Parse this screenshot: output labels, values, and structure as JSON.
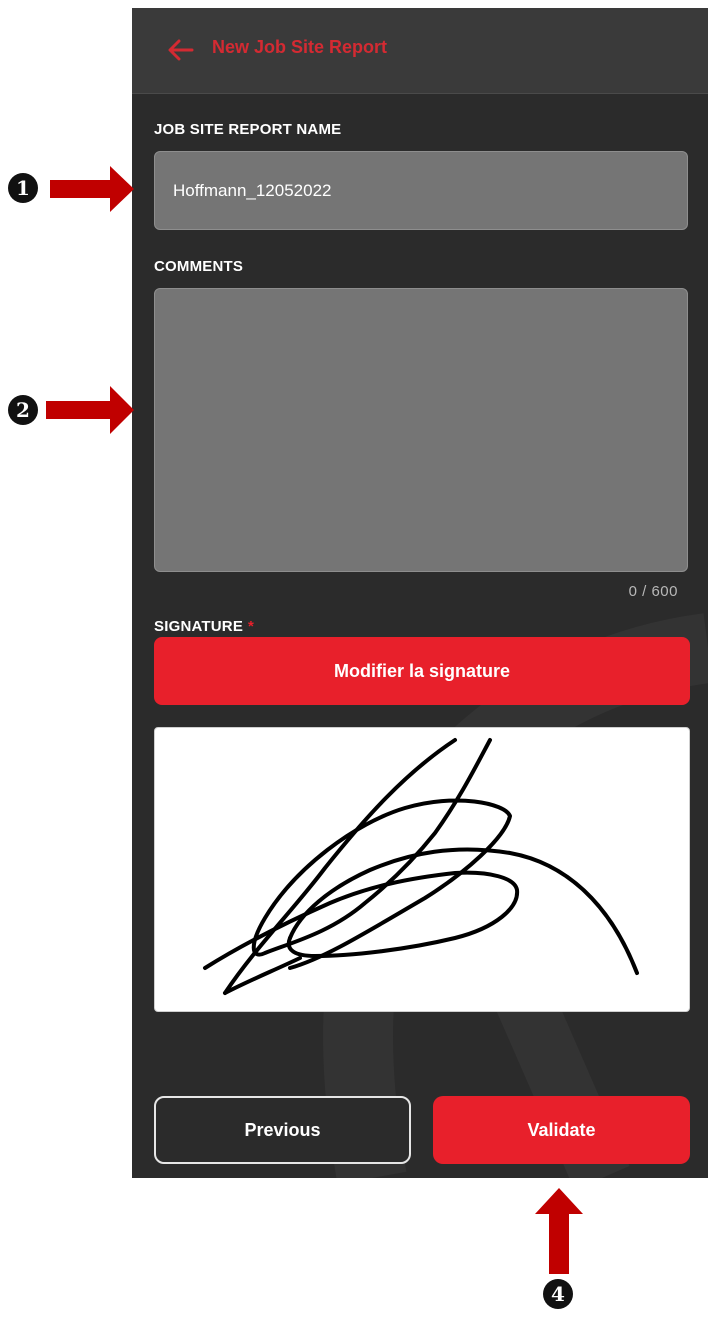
{
  "header": {
    "title": "New Job Site Report",
    "back_icon": "arrow-left-icon"
  },
  "form": {
    "name_label": "JOB SITE REPORT NAME",
    "name_value": "Hoffmann_12052022",
    "comments_label": "COMMENTS",
    "comments_value": "",
    "comments_counter": "0 / 600",
    "signature_label": "SIGNATURE",
    "signature_required_mark": "*",
    "modify_signature_button": "Modifier la signature"
  },
  "footer": {
    "previous_button": "Previous",
    "validate_button": "Validate"
  },
  "annotations": [
    {
      "number": "1",
      "target": "job-site-report-name-input"
    },
    {
      "number": "2",
      "target": "comments-field"
    },
    {
      "number": "4",
      "target": "validate-button"
    }
  ],
  "colors": {
    "accent": "#e8202b",
    "background": "#2b2b2b",
    "appbar": "#3a3a3a",
    "field": "#757575",
    "callout_arrow": "#c00000"
  }
}
